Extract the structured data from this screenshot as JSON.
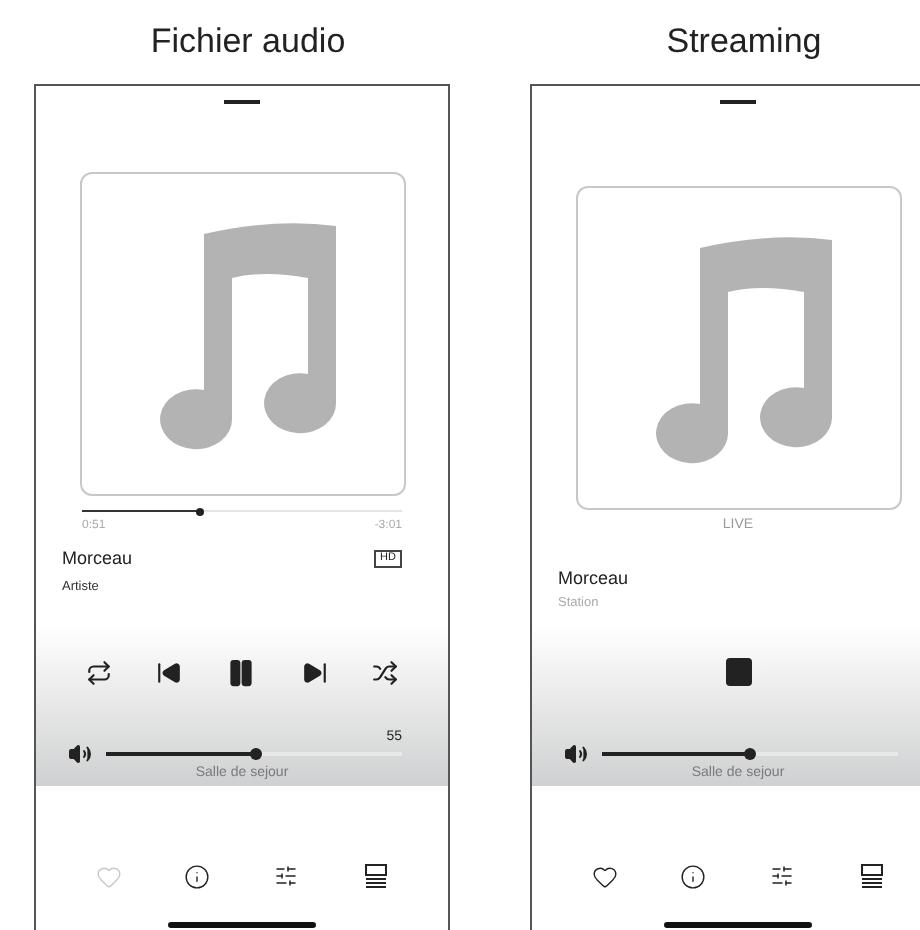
{
  "panels": [
    {
      "title": "Fichier audio",
      "kind": "file",
      "progress": {
        "level": 0.37,
        "elapsed": "0:51",
        "remaining": "-3:01"
      },
      "track": "Morceau",
      "badge": "HD",
      "subtitle": "Artiste",
      "controls": [
        {
          "kind": "repeat"
        },
        {
          "kind": "previous"
        },
        {
          "kind": "pause"
        },
        {
          "kind": "next"
        },
        {
          "kind": "shuffle"
        }
      ],
      "volume": {
        "level": 0.51,
        "reading": "55"
      },
      "room": "Salle de sejour",
      "favorite_disabled": true
    },
    {
      "title": "Streaming",
      "kind": "stream",
      "live": "LIVE",
      "track": "Morceau",
      "subtitle": "Station",
      "controls": [
        {
          "kind": "stop"
        }
      ],
      "volume": {
        "level": 0.5
      },
      "room": "Salle de sejour",
      "favorite_disabled": false
    }
  ]
}
